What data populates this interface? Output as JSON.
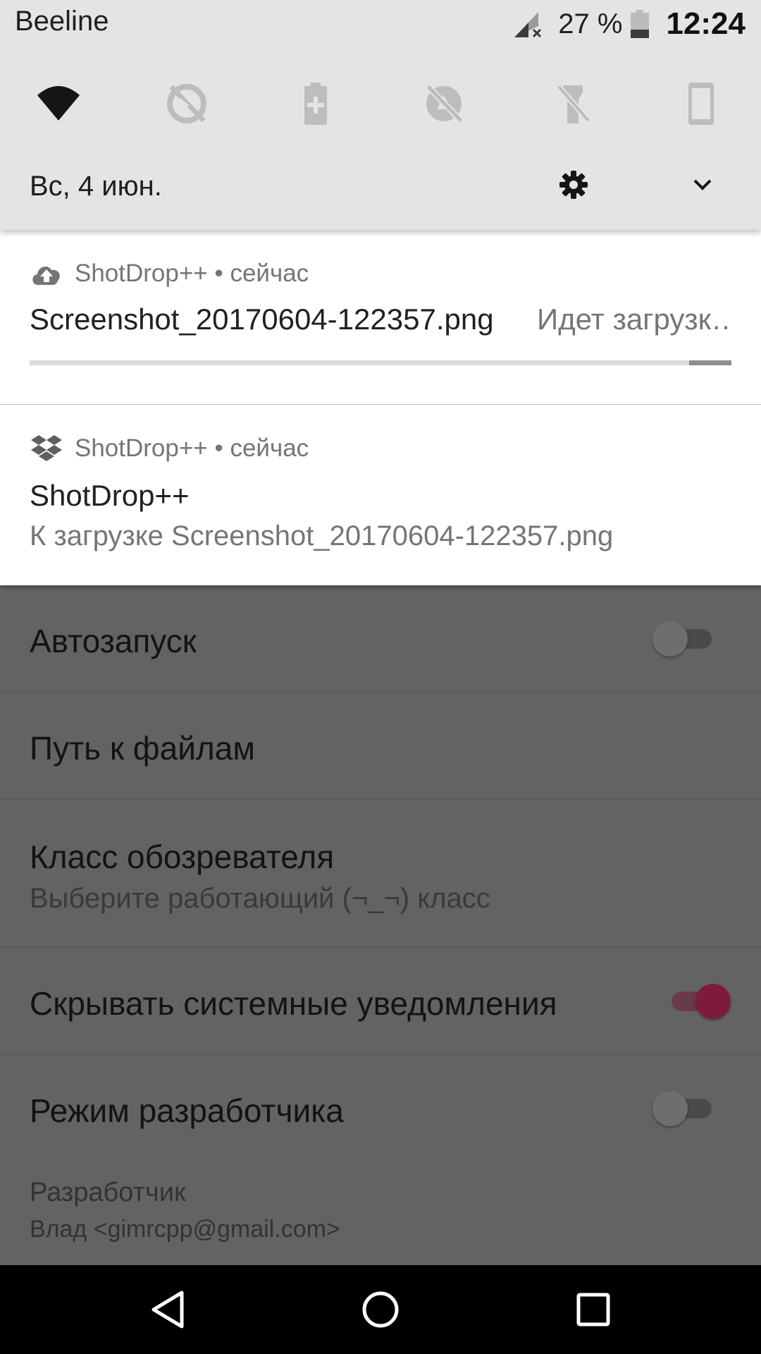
{
  "status_bar": {
    "carrier": "Beeline",
    "battery_percent": "27 %",
    "time": "12:24",
    "icons": [
      "signal-no-data-icon",
      "battery-icon"
    ]
  },
  "quick_settings": {
    "tiles": [
      {
        "name": "wifi-icon",
        "active": true
      },
      {
        "name": "sync-off-icon",
        "active": false
      },
      {
        "name": "battery-saver-icon",
        "active": false
      },
      {
        "name": "location-off-icon",
        "active": false
      },
      {
        "name": "flashlight-off-icon",
        "active": false
      },
      {
        "name": "auto-rotate-icon",
        "active": false
      }
    ],
    "date": "Вс, 4 июн.",
    "icons": [
      "gear-icon",
      "chevron-down-icon"
    ]
  },
  "notifications": [
    {
      "app_icon": "cloud-upload-icon",
      "app_line": "ShotDrop++ • сейчас",
      "title": "Screenshot_20170604-122357.png",
      "status": "Идет загрузк…",
      "progress": {
        "start": 0.94,
        "end": 1.0
      }
    },
    {
      "app_icon": "dropbox-icon",
      "app_line": "ShotDrop++ • сейчас",
      "title": "ShotDrop++",
      "body": "К загрузке Screenshot_20170604-122357.png"
    }
  ],
  "settings": [
    {
      "title": "Автозапуск",
      "switch": "off"
    },
    {
      "title": "Путь к файлам"
    },
    {
      "title": "Класс обозревателя",
      "summary": "Выберите работающий (¬_¬) класс"
    },
    {
      "title": "Скрывать системные уведомления",
      "switch": "on"
    },
    {
      "title": "Режим разработчика",
      "switch": "off"
    }
  ],
  "developer": {
    "label": "Разработчик",
    "value": "Влад <gimrcpp@gmail.com>"
  },
  "colors": {
    "shade_bg": "#e4e4e4",
    "dim_bg": "#636363",
    "accent_dimmed": "#7d1a3e"
  },
  "nav_bar": {
    "icons": [
      "back-icon",
      "home-icon",
      "recents-icon"
    ]
  }
}
